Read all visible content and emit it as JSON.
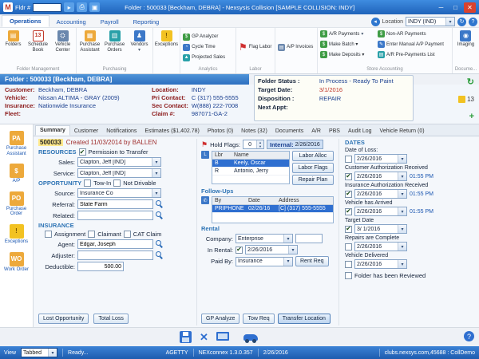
{
  "titlebar": {
    "logo": "M",
    "fldr_label": "Fldr #",
    "title": "Folder : 500033 [Beckham, DEBRA] - Nexsysis Collision [SAMPLE COLLISION: INDY]",
    "min": "─",
    "max": "□",
    "close": "✕"
  },
  "ribbon_tabs": {
    "t0": "Operations",
    "t1": "Accounting",
    "t2": "Payroll",
    "t3": "Reporting"
  },
  "location": {
    "label": "Location",
    "value": "INDY (IND)"
  },
  "ribbon": {
    "folders": "Folders",
    "schedule_badge": "13",
    "schedule_book": "Schedule Book",
    "vehicle_center": "Vehicle Center",
    "purchase_assistant": "Purchase Assistant",
    "purchase_orders": "Purchase Orders",
    "vendors": "Vendors",
    "exceptions": "Exceptions",
    "gp_analyzer": "GP Analyzer",
    "cycle_time": "Cycle Time",
    "projected_sales": "Projected Sales",
    "flag_labor": "Flag Labor",
    "ap_invoices": "A/P Invoices",
    "ar_payments": "A/R Payments",
    "make_batch": "Make Batch ▾",
    "make_deposits": "Make Deposits ▾",
    "non_ar_payments": "Non-AR Payments",
    "enter_manual_ap": "Enter Manual A/P Payment",
    "ar_prepayments": "A/R Pre-Payments List",
    "imaging": "Imaging",
    "groups": {
      "folder_management": "Folder Management",
      "purchasing": "Purchasing",
      "analytics": "Analytics",
      "labor": "Labor",
      "store_accounting": "Store Accounting",
      "documents": "Docume..."
    }
  },
  "folder_header": {
    "title": "Folder : 500033 [Beckham, DEBRA]"
  },
  "info": {
    "customer_label": "Customer:",
    "customer": "Beckham, DEBRA",
    "vehicle_label": "Vehicle:",
    "vehicle": "Nissan ALTIMA - GRAY (2009)",
    "insurance_label": "Insurance:",
    "insurance": "Nationwide Insurance",
    "fleet_label": "Fleet:",
    "fleet": "",
    "location_label": "Location:",
    "location": "INDY",
    "pri_label": "Pri Contact:",
    "pri": "C (317) 555-5555",
    "sec_label": "Sec Contact:",
    "sec": "W(888) 222-7008",
    "claim_label": "Claim #:",
    "claim": "987071-GA-2"
  },
  "status_panel": {
    "folder_status_label": "Folder Status :",
    "folder_status": "In Process - Ready To Paint",
    "target_date_label": "Target Date:",
    "target_date": "3/1/2016",
    "disposition_label": "Disposition :",
    "disposition": "REPAIR",
    "next_appt_label": "Next Appt:",
    "next_appt": "",
    "refresh": "↻",
    "count": "13",
    "plus": "+"
  },
  "sidebar": {
    "i0": "Purchase Assistant",
    "i1": "A/P",
    "i2": "Purchase Order",
    "i3": "Exceptions",
    "i4": "Work Order",
    "g0": "PA",
    "g1": "$",
    "g2": "PO",
    "g3": "!",
    "g4": "WO"
  },
  "doc_tabs": [
    "Summary",
    "Customer",
    "Notifications",
    "Estimates ($1,402.78)",
    "Photos (0)",
    "Notes (32)",
    "Documents",
    "A/R",
    "PBS",
    "Audit Log",
    "Vehicle Return (0)"
  ],
  "summary": {
    "folder_no": "500033",
    "created": "Created 11/03/2014 by BALLEN",
    "resources_label": "RESOURCES",
    "permission": "Permission to Transfer",
    "permission_mark": "✔",
    "sales_label": "Sales:",
    "sales": "Clapton, Jeff [IND]",
    "service_label": "Service:",
    "service": "Clapton, Jeff [IND]",
    "opportunity_label": "OPPORTUNITY",
    "tow_in": "Tow-In",
    "tow_in_mark": "",
    "not_drivable": "Not Drivable",
    "not_drivable_mark": "",
    "source_label": "Source:",
    "source": "Insurance Co",
    "referral_label": "Referral:",
    "referral": "State Farm",
    "related_label": "Related:",
    "related": "",
    "insurance_label": "INSURANCE",
    "assignment": "Assignment",
    "assignment_mark": "",
    "claimant": "Claimant",
    "claimant_mark": "",
    "cat_claim": "CAT Claim",
    "cat_claim_mark": "",
    "agent_label": "Agent:",
    "agent": "Edgar, Joseph",
    "adjuster_label": "Adjuster:",
    "adjuster": "",
    "deductible_label": "Deductible:",
    "deductible": "500.00",
    "lost_opportunity": "Lost Opportunity",
    "total_loss": "Total Loss",
    "hold_flags_label": "Hold Flags:",
    "hold_flags": "0",
    "internal_label": "Internal:",
    "internal_date": "2/26/2016",
    "labor_grid": {
      "h0": "Lbr",
      "h1": "Name",
      "rows": [
        {
          "c0": "B",
          "c1": "Keely, Oscar"
        },
        {
          "c0": "R",
          "c1": "Antonio, Jerry"
        }
      ]
    },
    "labor_alloc": "Labor Alloc",
    "labor_flags": "Labor Flags",
    "repair_plan": "Repair Plan",
    "followups_label": "Follow-Ups",
    "followups_grid": {
      "h0": "By",
      "h1": "Date",
      "h2": "Address",
      "row": {
        "c0": "PRIPHONE",
        "c1": "02/26/16",
        "c2": "[C] (317) 555-5555"
      }
    },
    "rental_label": "Rental",
    "company_label": "Company:",
    "company": "Enterprise",
    "in_rental_label": "In Rental:",
    "in_rental_mark": "✔",
    "in_rental_date": "2/26/2016",
    "paid_by_label": "Paid By:",
    "paid_by": "Insurance",
    "rent_req": "Rent Req",
    "gp_analyze": "GP Analyze",
    "tow_req": "Tow Req",
    "transfer_location": "Transfer Location"
  },
  "dates": {
    "title": "DATES",
    "items": [
      {
        "label": "Date of Loss:",
        "mark": "",
        "date": "2/26/2016",
        "time": ""
      },
      {
        "label": "Customer Authorization Received",
        "mark": "✔",
        "date": "2/26/2016",
        "time": "01:55 PM"
      },
      {
        "label": "Insurance Authorization Received",
        "mark": "✔",
        "date": "2/26/2016",
        "time": "01:55 PM"
      },
      {
        "label": "Vehicle has Arrived",
        "mark": "✔",
        "date": "2/26/2016",
        "time": "01:55 PM"
      },
      {
        "label": "Target Date",
        "mark": "✔",
        "date": "3/ 1/2016",
        "time": ""
      },
      {
        "label": "Repairs are Complete",
        "mark": "",
        "date": "2/26/2016",
        "time": ""
      },
      {
        "label": "Vehicle Delivered",
        "mark": "",
        "date": "2/26/2016",
        "time": ""
      }
    ],
    "reviewed": "Folder has been Reviewed",
    "reviewed_mark": ""
  },
  "statusbar": {
    "view_label": "View",
    "view_value": "Tabbed",
    "ready": "Ready...",
    "user": "AGETTY",
    "version": "NEXconnex 1.3.0.357",
    "date": "2/26/2016",
    "server": "clubs.nexsys.com,45688 : CollDemo"
  }
}
